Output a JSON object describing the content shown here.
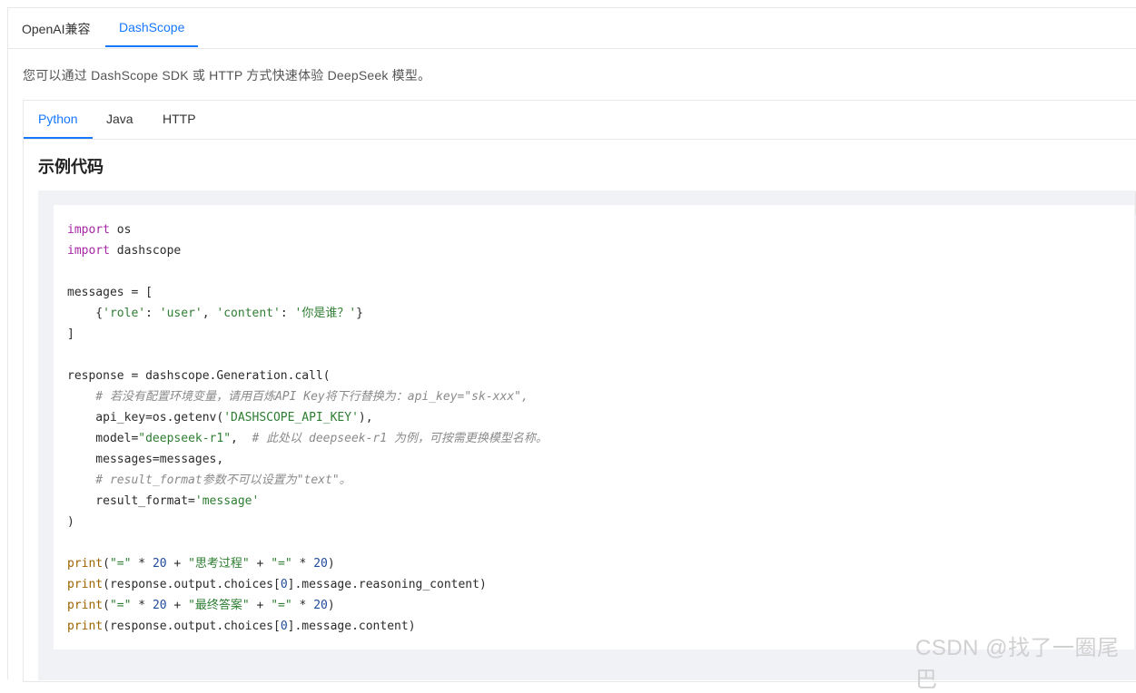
{
  "top_tabs": {
    "openai": "OpenAI兼容",
    "dashscope": "DashScope"
  },
  "description": "您可以通过 DashScope SDK 或 HTTP 方式快速体验 DeepSeek 模型。",
  "lang_tabs": {
    "python": "Python",
    "java": "Java",
    "http": "HTTP"
  },
  "section_title": "示例代码",
  "code": {
    "l1_kw": "import",
    "l1_rest": " os",
    "l2_kw": "import",
    "l2_rest": " dashscope",
    "l4": "messages = [",
    "l5_a": "    {",
    "l5_k1": "'role'",
    "l5_b": ": ",
    "l5_v1": "'user'",
    "l5_c": ", ",
    "l5_k2": "'content'",
    "l5_d": ": ",
    "l5_v2": "'你是谁？'",
    "l5_e": "}",
    "l6": "]",
    "l8": "response = dashscope.Generation.call(",
    "l9": "    # 若没有配置环境变量，请用百炼API Key将下行替换为：api_key=\"sk-xxx\",",
    "l10_a": "    api_key=os.getenv(",
    "l10_s": "'DASHSCOPE_API_KEY'",
    "l10_b": "),",
    "l11_a": "    model=",
    "l11_s": "\"deepseek-r1\"",
    "l11_b": ",  ",
    "l11_c": "# 此处以 deepseek-r1 为例，可按需更换模型名称。",
    "l12": "    messages=messages,",
    "l13": "    # result_format参数不可以设置为\"text\"。",
    "l14_a": "    result_format=",
    "l14_s": "'message'",
    "l15": ")",
    "p1_f": "print",
    "p1_a": "(",
    "p1_s1": "\"=\"",
    "p1_b": " * ",
    "p1_n1": "20",
    "p1_c": " + ",
    "p1_s2": "\"思考过程\"",
    "p1_d": " + ",
    "p1_s3": "\"=\"",
    "p1_e": " * ",
    "p1_n2": "20",
    "p1_g": ")",
    "p2_f": "print",
    "p2_a": "(response.output.choices[",
    "p2_n": "0",
    "p2_b": "].message.reasoning_content)",
    "p3_f": "print",
    "p3_a": "(",
    "p3_s1": "\"=\"",
    "p3_b": " * ",
    "p3_n1": "20",
    "p3_c": " + ",
    "p3_s2": "\"最终答案\"",
    "p3_d": " + ",
    "p3_s3": "\"=\"",
    "p3_e": " * ",
    "p3_n2": "20",
    "p3_g": ")",
    "p4_f": "print",
    "p4_a": "(response.output.choices[",
    "p4_n": "0",
    "p4_b": "].message.content)"
  },
  "watermark": "CSDN @找了一圈尾巴",
  "icons": {
    "copy": "copy-icon"
  }
}
